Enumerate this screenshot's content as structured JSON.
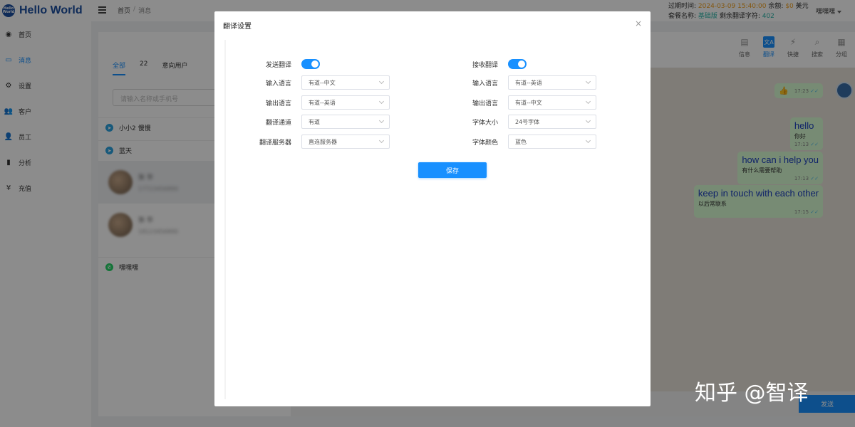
{
  "app": {
    "logo_badge": "Hello World",
    "logo_text": "Hello World"
  },
  "header": {
    "breadcrumb": [
      "首页",
      "消息"
    ],
    "breadcrumb_sep": "/",
    "expire_label": "过期时间:",
    "expire_value": "2024-03-09 15:40:00",
    "balance_label": "余额:",
    "balance_value": "$0",
    "balance_unit": "美元",
    "plan_label": "套餐名称:",
    "plan_value": "基础版",
    "chars_label": "剩余翻译字符:",
    "chars_value": "402",
    "user_name": "嘿嘿嘿"
  },
  "sidebar": {
    "items": [
      {
        "label": "首页",
        "icon": "dashboard-icon",
        "glyph": "◉",
        "active": false
      },
      {
        "label": "消息",
        "icon": "message-icon",
        "glyph": "▭",
        "active": true
      },
      {
        "label": "设置",
        "icon": "gear-icon",
        "glyph": "⚙",
        "active": false
      },
      {
        "label": "客户",
        "icon": "customers-icon",
        "glyph": "👥",
        "active": false
      },
      {
        "label": "员工",
        "icon": "user-icon",
        "glyph": "👤",
        "active": false
      },
      {
        "label": "分析",
        "icon": "bar-chart-icon",
        "glyph": "▮",
        "active": false
      },
      {
        "label": "充值",
        "icon": "yen-icon",
        "glyph": "¥",
        "active": false
      }
    ]
  },
  "contacts": {
    "tabs": [
      "全部",
      "22",
      "意向用户"
    ],
    "search_placeholder": "请输入名称或手机号",
    "groups": [
      {
        "name": "小小2 慢慢",
        "platform": "telegram"
      },
      {
        "name": "蓝天",
        "platform": "telegram"
      },
      {
        "name": "嘿嘿嘿",
        "platform": "whatsapp"
      }
    ],
    "items": [
      {
        "name": "张 华",
        "sub": "17723456890"
      },
      {
        "name": "张 华",
        "sub": "18123456890"
      }
    ]
  },
  "chat": {
    "tools": [
      {
        "label": "信息",
        "icon": "info-icon",
        "glyph": "▤"
      },
      {
        "label": "翻译",
        "icon": "translate-icon",
        "glyph": "文A"
      },
      {
        "label": "快捷",
        "icon": "lightning-icon",
        "glyph": "⚡"
      },
      {
        "label": "搜索",
        "icon": "search-icon",
        "glyph": "⌕"
      },
      {
        "label": "分组",
        "icon": "group-icon",
        "glyph": "▦"
      }
    ],
    "messages": [
      {
        "en": "👍",
        "zh": "",
        "time": "17:23"
      },
      {
        "en": "hello",
        "zh": "你好",
        "time": "17:13"
      },
      {
        "en": "how can i help you",
        "zh": "有什么需要帮助",
        "time": "17:13"
      },
      {
        "en": "keep in touch with each other",
        "zh": "以后常联系",
        "time": "17:15"
      }
    ],
    "check_glyph": "✓✓",
    "send_label": "发送"
  },
  "modal": {
    "title": "翻译设置",
    "close_glyph": "×",
    "left": {
      "send_translate_label": "发送翻译",
      "send_translate_on": true,
      "input_lang_label": "输入语言",
      "input_lang_value": "有道--中文",
      "output_lang_label": "输出语言",
      "output_lang_value": "有道--英语",
      "channel_label": "翻译通道",
      "channel_value": "有道",
      "server_label": "翻译服务器",
      "server_value": "直连服务器"
    },
    "right": {
      "recv_translate_label": "接收翻译",
      "recv_translate_on": true,
      "input_lang_label": "输入语言",
      "input_lang_value": "有道--英语",
      "output_lang_label": "输出语言",
      "output_lang_value": "有道--中文",
      "font_size_label": "字体大小",
      "font_size_value": "24号字体",
      "font_color_label": "字体颜色",
      "font_color_value": "蓝色"
    },
    "save_label": "保存"
  },
  "watermark": "知乎 @智译"
}
